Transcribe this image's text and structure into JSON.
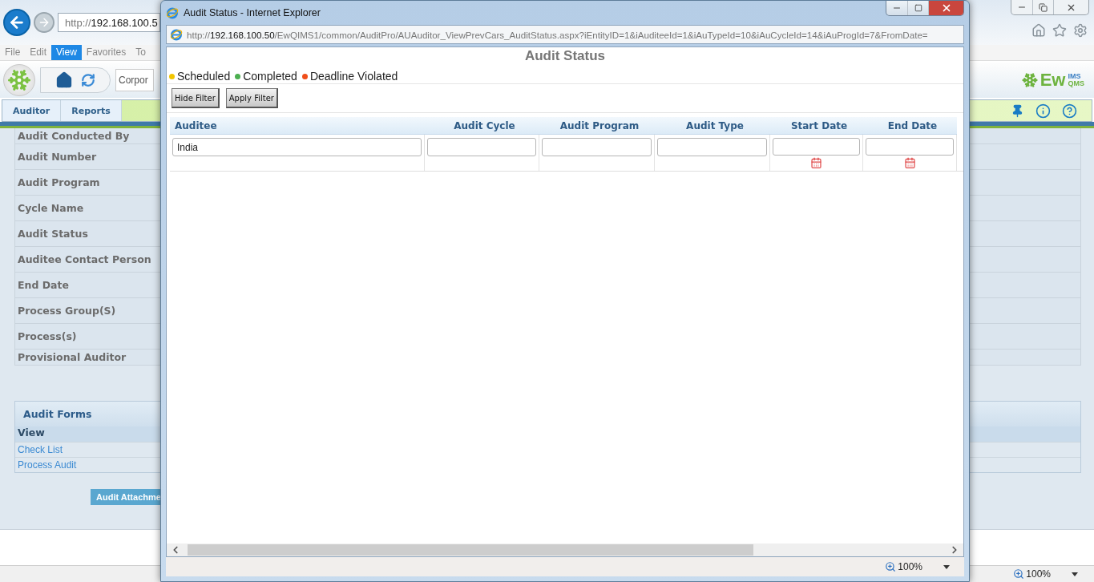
{
  "browser": {
    "address": {
      "scheme": "http://",
      "host": "192.168.100.5"
    },
    "menu": [
      {
        "label": "File",
        "selected": false
      },
      {
        "label": "Edit",
        "selected": false
      },
      {
        "label": "View",
        "selected": true
      },
      {
        "label": "Favorites",
        "selected": false
      },
      {
        "label": "To",
        "selected": false
      }
    ],
    "zoom": "100%"
  },
  "app": {
    "search_value": "Corpor",
    "logo": {
      "text": "Ew",
      "sup": "IMS",
      "sub": "QMS"
    },
    "nav_tabs": [
      "Auditor",
      "Reports"
    ]
  },
  "details": [
    "Audit Conducted By",
    "Audit Number",
    "Audit Program",
    "Cycle Name",
    "Audit Status",
    "Auditee Contact Person",
    "End Date",
    "Process Group(S)",
    "Process(s)",
    "Provisional Auditor"
  ],
  "audit_forms": {
    "title": "Audit Forms",
    "column": "View",
    "links": [
      "Check List",
      "Process Audit"
    ]
  },
  "attachment_button": "Audit Attachme",
  "popup": {
    "title": "Audit Status - Internet Explorer",
    "address": {
      "scheme": "http://",
      "host": "192.168.100.50",
      "path": "/EwQIMS1/common/AuditPro/AUAuditor_ViewPrevCars_AuditStatus.aspx?iEntityID=1&iAuditeeId=1&iAuTypeId=10&iAuCycleId=14&iAuProgId=7&FromDate="
    },
    "heading": "Audit Status",
    "legend": [
      {
        "label": "Scheduled",
        "color": "#f2c500"
      },
      {
        "label": "Completed",
        "color": "#4caf50"
      },
      {
        "label": "Deadline Violated",
        "color": "#f04e1a"
      }
    ],
    "buttons": [
      "Hide Filter",
      "Apply Filter"
    ],
    "columns": [
      {
        "label": "Auditee",
        "kind": "text",
        "value": "India"
      },
      {
        "label": "Audit Cycle",
        "kind": "text"
      },
      {
        "label": "Audit Program",
        "kind": "text"
      },
      {
        "label": "Audit Type",
        "kind": "text"
      },
      {
        "label": "Start Date",
        "kind": "date"
      },
      {
        "label": "End Date",
        "kind": "date"
      }
    ],
    "zoom": "100%"
  }
}
